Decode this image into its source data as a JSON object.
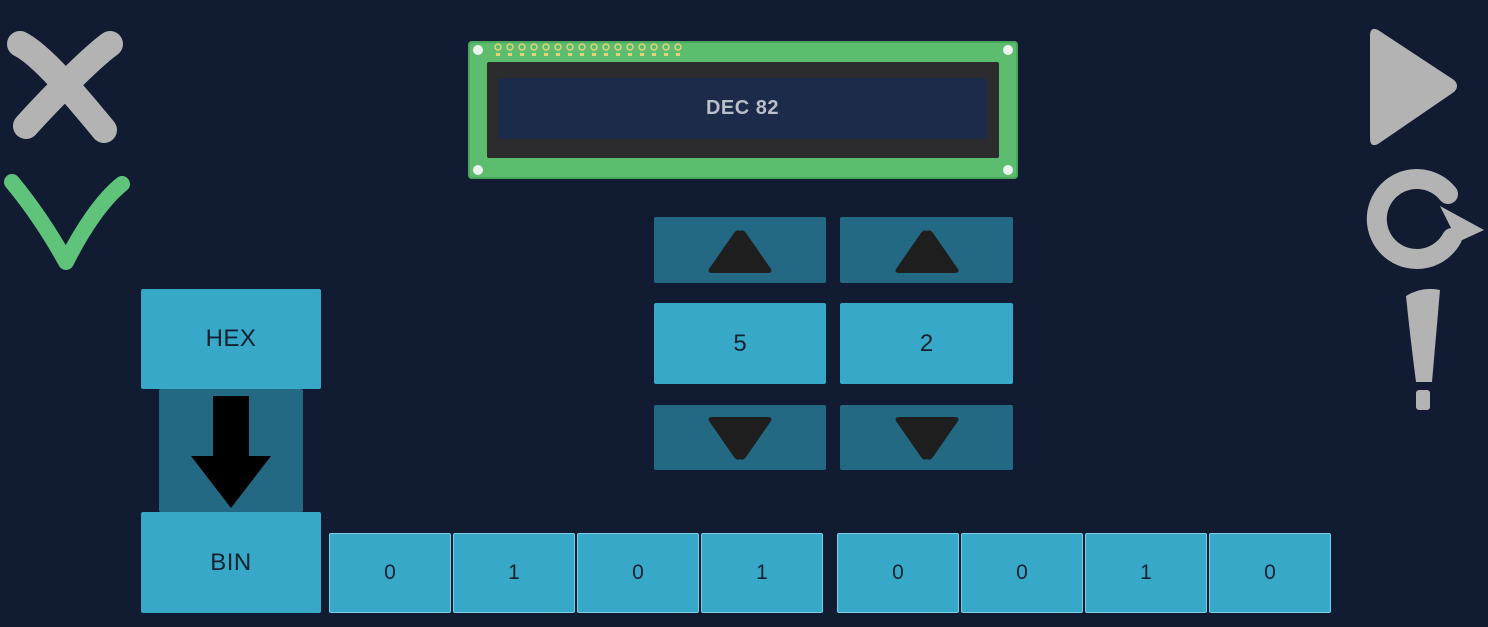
{
  "lcd": {
    "text": "DEC 82"
  },
  "mode": {
    "from_label": "HEX",
    "to_label": "BIN"
  },
  "digits": [
    {
      "value": "5"
    },
    {
      "value": "2"
    }
  ],
  "bits": [
    "0",
    "1",
    "0",
    "1",
    "0",
    "0",
    "1",
    "0"
  ],
  "icons": {
    "close": "close-icon",
    "check": "check-icon",
    "play": "play-icon",
    "restart": "restart-icon",
    "hint": "exclamation-icon",
    "conversion_arrow": "arrow-down-icon",
    "increment": "triangle-up-icon",
    "decrement": "triangle-down-icon"
  },
  "colors": {
    "background": "#111b31",
    "button": "#37a8c8",
    "button_dark": "#236983",
    "lcd_board": "#5cbd6e",
    "lcd_screen": "#1d2b4b",
    "check": "#5fc37a",
    "icon_gray": "#b3b3b3"
  }
}
